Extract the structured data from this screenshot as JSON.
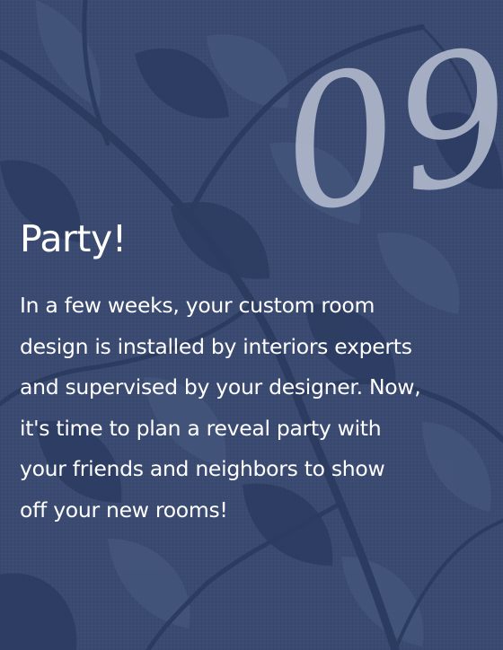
{
  "card": {
    "step_number": "09",
    "title": "Party!",
    "body_lines": [
      "In a few weeks, your custom room",
      "design is installed by interiors experts",
      "and supervised by your designer. Now,",
      "it's time to plan a reveal party with",
      "your friends and neighbors to show",
      "off your new rooms!"
    ]
  },
  "colors": {
    "background": "#3a4a70",
    "branch_dark": "#2c3b60",
    "branch_light": "#46577d",
    "number": "#b8c0d2",
    "text": "#ffffff"
  },
  "icons": {
    "background_art": "tree-branch-illustration"
  }
}
